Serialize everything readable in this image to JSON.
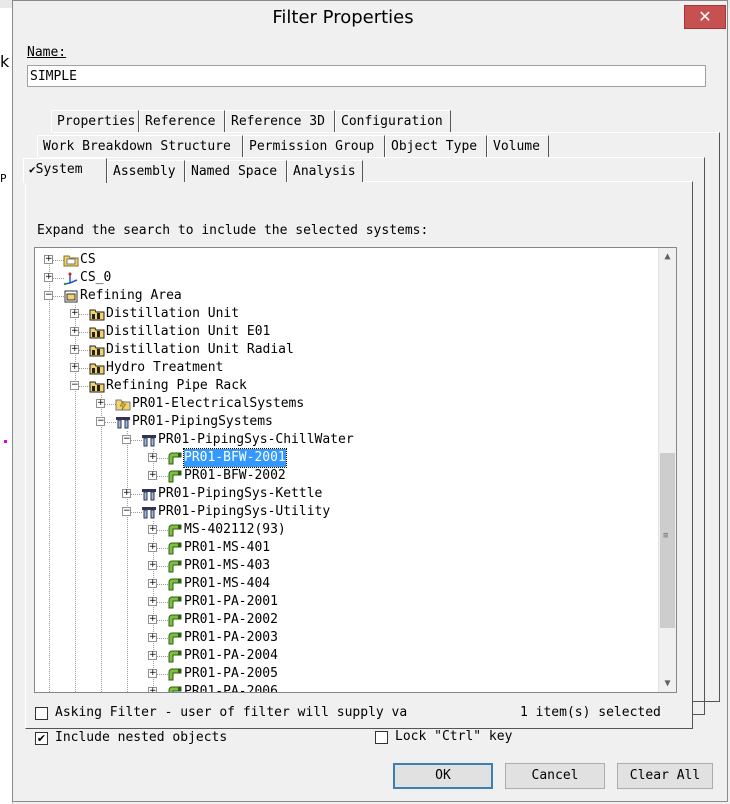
{
  "background": {
    "letter": "k",
    "partial": "P"
  },
  "window": {
    "title": "Filter Properties",
    "close": "✕"
  },
  "name": {
    "label": "Name:",
    "value": "SIMPLE"
  },
  "tabs": {
    "row1": [
      "Properties",
      "Reference",
      "Reference 3D",
      "Configuration"
    ],
    "row2": [
      "Work Breakdown Structure",
      "Permission Group",
      "Object Type",
      "Volume"
    ],
    "row3": [
      "System",
      "Assembly",
      "Named Space",
      "Analysis"
    ],
    "active": "System",
    "active_check": "✔"
  },
  "expand_label": "Expand the search to include the selected systems:",
  "tree": {
    "items": [
      {
        "label": "CS",
        "level": 0,
        "expander": "+",
        "icon": "folder-icon"
      },
      {
        "label": "CS_0",
        "level": 0,
        "expander": "+",
        "icon": "coordinate-system-icon"
      },
      {
        "label": "Refining Area",
        "level": 0,
        "expander": "−",
        "icon": "area-icon"
      },
      {
        "label": "Distillation Unit",
        "level": 1,
        "expander": "+",
        "icon": "unit-icon"
      },
      {
        "label": "Distillation Unit E01",
        "level": 1,
        "expander": "+",
        "icon": "unit-icon"
      },
      {
        "label": "Distillation Unit Radial",
        "level": 1,
        "expander": "+",
        "icon": "unit-icon"
      },
      {
        "label": "Hydro Treatment",
        "level": 1,
        "expander": "+",
        "icon": "unit-icon"
      },
      {
        "label": "Refining Pipe Rack",
        "level": 1,
        "expander": "−",
        "icon": "unit-icon"
      },
      {
        "label": "PR01-ElectricalSystems",
        "level": 2,
        "expander": "+",
        "icon": "electrical-system-icon"
      },
      {
        "label": "PR01-PipingSystems",
        "level": 2,
        "expander": "−",
        "icon": "piping-system-icon"
      },
      {
        "label": "PR01-PipingSys-ChillWater",
        "level": 3,
        "expander": "−",
        "icon": "piping-system-icon"
      },
      {
        "label": "PR01-BFW-2001",
        "level": 4,
        "expander": "+",
        "icon": "pipeline-icon",
        "selected": true
      },
      {
        "label": "PR01-BFW-2002",
        "level": 4,
        "expander": "+",
        "icon": "pipeline-icon"
      },
      {
        "label": "PR01-PipingSys-Kettle",
        "level": 3,
        "expander": "+",
        "icon": "piping-system-icon"
      },
      {
        "label": "PR01-PipingSys-Utility",
        "level": 3,
        "expander": "−",
        "icon": "piping-system-icon"
      },
      {
        "label": "MS-402112(93)",
        "level": 4,
        "expander": "+",
        "icon": "pipeline-icon"
      },
      {
        "label": "PR01-MS-401",
        "level": 4,
        "expander": "+",
        "icon": "pipeline-icon"
      },
      {
        "label": "PR01-MS-403",
        "level": 4,
        "expander": "+",
        "icon": "pipeline-icon"
      },
      {
        "label": "PR01-MS-404",
        "level": 4,
        "expander": "+",
        "icon": "pipeline-icon"
      },
      {
        "label": "PR01-PA-2001",
        "level": 4,
        "expander": "+",
        "icon": "pipeline-icon"
      },
      {
        "label": "PR01-PA-2002",
        "level": 4,
        "expander": "+",
        "icon": "pipeline-icon"
      },
      {
        "label": "PR01-PA-2003",
        "level": 4,
        "expander": "+",
        "icon": "pipeline-icon"
      },
      {
        "label": "PR01-PA-2004",
        "level": 4,
        "expander": "+",
        "icon": "pipeline-icon"
      },
      {
        "label": "PR01-PA-2005",
        "level": 4,
        "expander": "+",
        "icon": "pipeline-icon"
      },
      {
        "label": "PR01-PA-2006",
        "level": 4,
        "expander": "+",
        "icon": "pipeline-icon"
      }
    ],
    "scroll_up": "▲",
    "scroll_down": "▼",
    "scroll_grip": "≡"
  },
  "options": {
    "asking_filter": {
      "label": "Asking Filter - user of filter will supply va",
      "checked": false
    },
    "selection_count": "1 item(s) selected",
    "include_nested": {
      "label": "Include nested objects",
      "checked": true,
      "mark": "✔"
    },
    "lock_ctrl": {
      "label": "Lock \"Ctrl\" key",
      "checked": false
    }
  },
  "buttons": {
    "ok": "OK",
    "cancel": "Cancel",
    "clear_all": "Clear All"
  },
  "colors": {
    "selection": "#3399ff",
    "close": "#c75050",
    "default_button": "#3c7fb1"
  }
}
